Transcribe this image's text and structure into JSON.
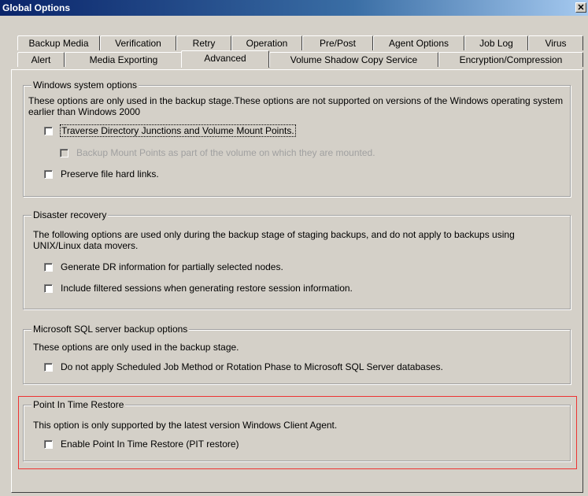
{
  "window": {
    "title": "Global Options",
    "close_glyph": "✕"
  },
  "tabs_row1": [
    "Backup Media",
    "Verification",
    "Retry",
    "Operation",
    "Pre/Post",
    "Agent Options",
    "Job Log",
    "Virus"
  ],
  "tabs_row2": [
    "Alert",
    "Media Exporting",
    "Advanced",
    "Volume Shadow Copy Service",
    "Encryption/Compression"
  ],
  "active_tab": "Advanced",
  "groups": {
    "windows": {
      "title": "Windows system options",
      "desc": "These options are only used in the backup stage.These options are not supported on versions of the Windows operating system earlier than Windows 2000",
      "options": [
        "Traverse Directory Junctions and Volume Mount Points.",
        "Backup Mount Points as part of the volume on which they are mounted.",
        "Preserve file hard links."
      ]
    },
    "disaster": {
      "title": "Disaster recovery",
      "desc": "The following options are used only during the backup stage of staging backups, and do not apply to backups using UNIX/Linux data movers.",
      "options": [
        "Generate DR information for partially selected nodes.",
        "Include filtered sessions when generating restore session information."
      ]
    },
    "sql": {
      "title": "Microsoft SQL server backup options",
      "desc": "These options are only used in the backup stage.",
      "options": [
        "Do not apply Scheduled Job Method or Rotation Phase to Microsoft SQL Server databases."
      ]
    },
    "pit": {
      "title": "Point In Time Restore",
      "desc": "This option is only supported by the latest version Windows Client Agent.",
      "options": [
        "Enable Point In Time Restore (PIT restore)"
      ]
    }
  },
  "colors": {
    "dialog": "#d4d0c8",
    "titlebar": "#0a246a",
    "highlight": "#e33333"
  }
}
